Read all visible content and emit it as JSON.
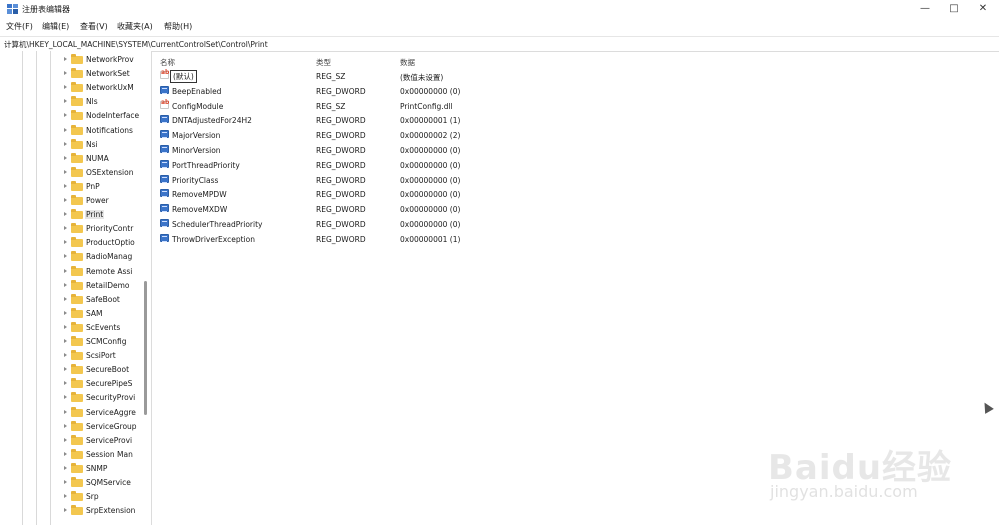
{
  "window": {
    "title": "注册表编辑器",
    "minimize_glyph": "—",
    "maximize_glyph": "□",
    "close_glyph": "✕"
  },
  "menu": [
    "文件(F)",
    "编辑(E)",
    "查看(V)",
    "收藏夹(A)",
    "帮助(H)"
  ],
  "address": "计算机\\HKEY_LOCAL_MACHINE\\SYSTEM\\CurrentControlSet\\Control\\Print",
  "tree": {
    "items": [
      "NetworkProv",
      "NetworkSet",
      "NetworkUxM",
      "Nls",
      "NodeInterface",
      "Notifications",
      "Nsi",
      "NUMA",
      "OSExtension",
      "PnP",
      "Power",
      "Print",
      "PriorityContr",
      "ProductOptio",
      "RadioManag",
      "Remote Assi",
      "RetailDemo",
      "SafeBoot",
      "SAM",
      "ScEvents",
      "SCMConfig",
      "ScsiPort",
      "SecureBoot",
      "SecurePipeS",
      "SecurityProvi",
      "ServiceAggre",
      "ServiceGroup",
      "ServiceProvi",
      "Session Man",
      "SNMP",
      "SQMService",
      "Srp",
      "SrpExtension"
    ],
    "selected_index": 11
  },
  "columns": {
    "name": "名称",
    "type": "类型",
    "data": "数据"
  },
  "values": [
    {
      "name": "(默认)",
      "type": "REG_SZ",
      "data": "(数值未设置)",
      "icon": "sz"
    },
    {
      "name": "BeepEnabled",
      "type": "REG_DWORD",
      "data": "0x00000000 (0)",
      "icon": "dword"
    },
    {
      "name": "ConfigModule",
      "type": "REG_SZ",
      "data": "PrintConfig.dll",
      "icon": "sz"
    },
    {
      "name": "DNTAdjustedFor24H2",
      "type": "REG_DWORD",
      "data": "0x00000001 (1)",
      "icon": "dword"
    },
    {
      "name": "MajorVersion",
      "type": "REG_DWORD",
      "data": "0x00000002 (2)",
      "icon": "dword"
    },
    {
      "name": "MinorVersion",
      "type": "REG_DWORD",
      "data": "0x00000000 (0)",
      "icon": "dword"
    },
    {
      "name": "PortThreadPriority",
      "type": "REG_DWORD",
      "data": "0x00000000 (0)",
      "icon": "dword"
    },
    {
      "name": "PriorityClass",
      "type": "REG_DWORD",
      "data": "0x00000000 (0)",
      "icon": "dword"
    },
    {
      "name": "RemoveMPDW",
      "type": "REG_DWORD",
      "data": "0x00000000 (0)",
      "icon": "dword"
    },
    {
      "name": "RemoveMXDW",
      "type": "REG_DWORD",
      "data": "0x00000000 (0)",
      "icon": "dword"
    },
    {
      "name": "SchedulerThreadPriority",
      "type": "REG_DWORD",
      "data": "0x00000000 (0)",
      "icon": "dword"
    },
    {
      "name": "ThrowDriverException",
      "type": "REG_DWORD",
      "data": "0x00000001 (1)",
      "icon": "dword"
    }
  ],
  "watermark": {
    "logo": "Baidu经验",
    "url": "jingyan.baidu.com"
  }
}
